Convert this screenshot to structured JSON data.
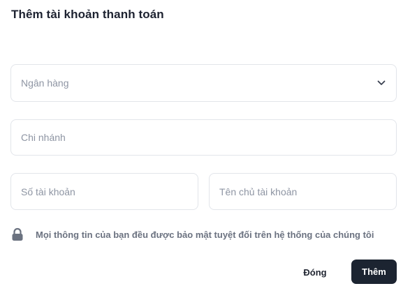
{
  "dialog": {
    "title": "Thêm tài khoản thanh toán"
  },
  "form": {
    "bank": {
      "placeholder": "Ngân hàng",
      "icon": "chevron-down-icon"
    },
    "branch": {
      "placeholder": "Chi nhánh"
    },
    "account_number": {
      "placeholder": "Số tài khoản"
    },
    "account_holder": {
      "placeholder": "Tên chủ tài khoản"
    }
  },
  "notice": {
    "icon": "lock-icon",
    "text": "Mọi thông tin của bạn đều được bảo mật tuyệt đối trên hệ thống của chúng tôi"
  },
  "actions": {
    "close_label": "Đóng",
    "add_label": "Thêm"
  },
  "colors": {
    "primary_button": "#1c2431",
    "border": "#e2e5ea",
    "placeholder": "#8e95a3",
    "muted_text": "#6b7280"
  }
}
